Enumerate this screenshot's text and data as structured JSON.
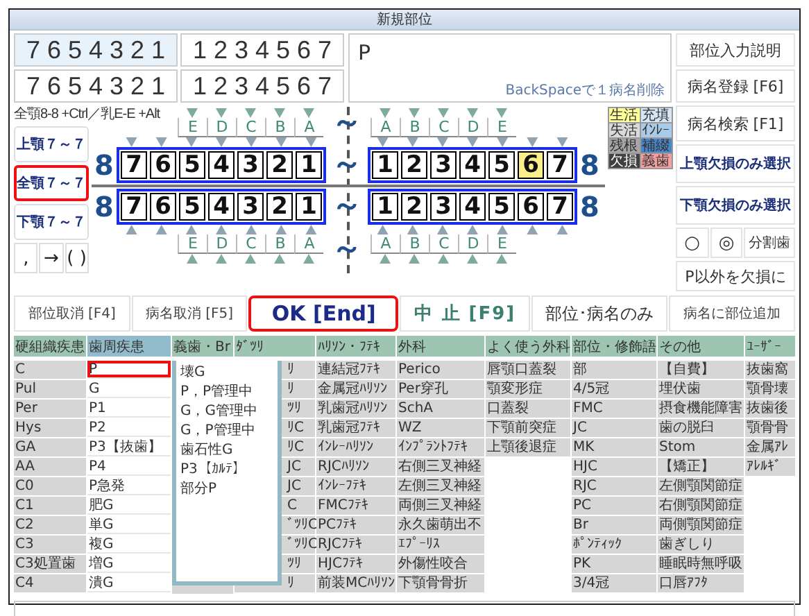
{
  "window": {
    "title": "新規部位"
  },
  "site_inputs": [
    [
      {
        "text": "7 6 5 4 3 2 1",
        "selected": true
      },
      {
        "text": "1 2 3 4 5 6 7",
        "selected": false
      }
    ],
    [
      {
        "text": "7 6 5 4 3 2 1",
        "selected": false
      },
      {
        "text": "1 2 3 4 5 6 7",
        "selected": false
      }
    ]
  ],
  "disease_input": {
    "value": "P",
    "hint": "BackSpaceで１病名削除"
  },
  "right_buttons": [
    {
      "label": "部位入力説明",
      "kind": "plain"
    },
    {
      "label": "病名登録 [F6]",
      "kind": "plain"
    },
    {
      "label": "病名検索 [F1]",
      "kind": "plain"
    },
    {
      "label": "上顎欠損のみ選択",
      "kind": "select"
    },
    {
      "label": "下顎欠損のみ選択",
      "kind": "select"
    }
  ],
  "mark_buttons": [
    "○",
    "◎",
    "分割歯"
  ],
  "missing_button": "P以外を欠損に",
  "shortcut_hint": "全顎8-8 +Ctrl／乳E-E +Alt",
  "jaw_buttons": [
    {
      "label": "上顎７～７",
      "selected": false
    },
    {
      "label": "全顎７～７",
      "selected": true
    },
    {
      "label": "下顎７～７",
      "selected": false
    }
  ],
  "symbol_keys": [
    ",",
    "→",
    "( )"
  ],
  "legend": [
    {
      "label": "生活",
      "color": "#ffff99"
    },
    {
      "label": "充填",
      "color": "#d6e6f5"
    },
    {
      "label": "失活",
      "color": "#d9d9d9"
    },
    {
      "label": "ｲﾝﾚｰ",
      "color": "#a9cbe8"
    },
    {
      "label": "残根",
      "color": "#a6a6a6"
    },
    {
      "label": "補綴",
      "color": "#4a86c5"
    },
    {
      "label": "欠損",
      "color": "#404040"
    },
    {
      "label": "義歯",
      "color": "#f4a0a0"
    }
  ],
  "chart": {
    "upper_deciduous": {
      "left": [
        "E",
        "D",
        "C",
        "B",
        "A"
      ],
      "tilde": "～",
      "right": [
        "A",
        "B",
        "C",
        "D",
        "E"
      ]
    },
    "upper": {
      "left_end": "8",
      "left": [
        {
          "label": "7",
          "marked": false
        },
        {
          "label": "6",
          "marked": false
        },
        {
          "label": "5",
          "marked": false
        },
        {
          "label": "4",
          "marked": false
        },
        {
          "label": "3",
          "marked": false
        },
        {
          "label": "2",
          "marked": false
        },
        {
          "label": "1",
          "marked": false
        }
      ],
      "tilde": "～",
      "right": [
        {
          "label": "1",
          "marked": false
        },
        {
          "label": "2",
          "marked": false
        },
        {
          "label": "3",
          "marked": false
        },
        {
          "label": "4",
          "marked": false
        },
        {
          "label": "5",
          "marked": false
        },
        {
          "label": "6",
          "marked": true
        },
        {
          "label": "7",
          "marked": false
        }
      ],
      "right_end": "8"
    },
    "lower": {
      "left_end": "8",
      "left": [
        {
          "label": "7",
          "marked": false
        },
        {
          "label": "6",
          "marked": false
        },
        {
          "label": "5",
          "marked": false
        },
        {
          "label": "4",
          "marked": false
        },
        {
          "label": "3",
          "marked": false
        },
        {
          "label": "2",
          "marked": false
        },
        {
          "label": "1",
          "marked": false
        }
      ],
      "tilde": "～",
      "right": [
        {
          "label": "1",
          "marked": false
        },
        {
          "label": "2",
          "marked": false
        },
        {
          "label": "3",
          "marked": false
        },
        {
          "label": "4",
          "marked": false
        },
        {
          "label": "5",
          "marked": false
        },
        {
          "label": "6",
          "marked": false
        },
        {
          "label": "7",
          "marked": false
        }
      ],
      "right_end": "8"
    },
    "lower_deciduous": {
      "left": [
        "E",
        "D",
        "C",
        "B",
        "A"
      ],
      "tilde": "～",
      "right": [
        "A",
        "B",
        "C",
        "D",
        "E"
      ]
    }
  },
  "actions": [
    {
      "label": "部位取消 [F4]",
      "kind": "plain",
      "focused": false
    },
    {
      "label": "病名取消 [F5]",
      "kind": "plain",
      "focused": false
    },
    {
      "label": "OK [End]",
      "kind": "ok",
      "focused": true
    },
    {
      "label": "中 止 [F9]",
      "kind": "stop",
      "focused": false
    },
    {
      "label": "部位･病名のみ",
      "kind": "large",
      "focused": false
    },
    {
      "label": "病名に部位追加",
      "kind": "plain",
      "focused": false
    }
  ],
  "tabs": [
    {
      "label": "硬組織疾患",
      "selected": false
    },
    {
      "label": "歯周疾患",
      "selected": true
    },
    {
      "label": "義歯・Br",
      "selected": false
    },
    {
      "label": "ﾀﾞﾂﾘ",
      "selected": false
    },
    {
      "label": "ﾊﾘｿﾝ・ﾌﾃｷ",
      "selected": false
    },
    {
      "label": "外科",
      "selected": false
    },
    {
      "label": "よく使う外科",
      "selected": false
    },
    {
      "label": "部位・修飾語",
      "selected": false
    },
    {
      "label": "その他",
      "selected": false
    },
    {
      "label": "ﾕｰｻﾞｰ",
      "selected": false
    }
  ],
  "columns": [
    {
      "kind": "list",
      "first_cell_focused": false,
      "cells": [
        "C",
        "Pul",
        "Per",
        "Hys",
        "GA",
        "AA",
        "C0",
        "C1",
        "C2",
        "C3",
        "C3処置歯",
        "C4"
      ]
    },
    {
      "kind": "list",
      "first_cell_focused": true,
      "cells": [
        "P",
        "G",
        "P1",
        "P2",
        "P3【抜歯】",
        "P4",
        "P急発",
        "肥G",
        "単G",
        "複G",
        "増G",
        "潰G"
      ]
    },
    {
      "kind": "covered"
    },
    {
      "kind": "partial",
      "first_cell_focused": false,
      "cells": [
        "ﾘ",
        "ﾘ",
        "ﾂﾘ",
        "ﾘC",
        "ﾘC",
        "JC",
        "JC",
        "C",
        "ﾞﾂﾘC",
        "ﾞﾂﾘC",
        "ﾂﾘ",
        "ﾘ"
      ]
    },
    {
      "kind": "list",
      "first_cell_focused": false,
      "cells": [
        "連結冠ﾌﾃｷ",
        "金属冠ﾊﾘｿﾝ",
        "乳歯冠ﾊﾘｿﾝ",
        "乳歯冠ﾌﾃｷ",
        "ｲﾝﾚｰﾊﾘｿﾝ",
        "RJCﾊﾘｿﾝ",
        "ｲﾝﾚｰﾌﾃｷ",
        "FMCﾌﾃｷ",
        "PCﾌﾃｷ",
        "RJCﾌﾃｷ",
        "HJCﾌﾃｷ",
        "前装MCﾊﾘｿﾝ"
      ]
    },
    {
      "kind": "list",
      "first_cell_focused": false,
      "cells": [
        "Perico",
        "Per穿孔",
        "SchA",
        "WZ",
        "ｲﾝﾌﾟﾗﾝﾄﾌﾃｷ",
        "右側三叉神経",
        "左側三叉神経",
        "両側三叉神経",
        "永久歯萌出不",
        "ｴﾌﾟｰﾘｽ",
        "外傷性咬合",
        "下顎骨骨折"
      ]
    },
    {
      "kind": "list",
      "first_cell_focused": false,
      "cells": [
        "唇顎口蓋裂",
        "顎変形症",
        "口蓋裂",
        "下顎前突症",
        "上顎後退症"
      ]
    },
    {
      "kind": "list",
      "first_cell_focused": false,
      "cells": [
        "部",
        "4/5冠",
        "FMC",
        "JC",
        "MK",
        "HJC",
        "RJC",
        "PC",
        "Br",
        "ﾎﾟﾝﾃｨｯｸ",
        "PK",
        "3/4冠"
      ]
    },
    {
      "kind": "list",
      "first_cell_focused": false,
      "cells": [
        "【自費】",
        "埋伏歯",
        "摂食機能障害",
        "歯の脱臼",
        "Stom",
        "【矯正】",
        "左側顎関節症",
        "右側顎関節症",
        "両側顎関節症",
        "歯ぎしり",
        "睡眠時無呼吸",
        "口唇ｱﾌﾀ"
      ]
    },
    {
      "kind": "list",
      "first_cell_focused": false,
      "cells": [
        "抜歯窩",
        "顎骨壊",
        "抜歯後",
        "顎骨骨",
        "金属ｱﾚ",
        "ｱﾚﾙｷﾞ"
      ]
    }
  ],
  "dropdown": {
    "items": [
      "壊G",
      "P，P管理中",
      "G，G管理中",
      "G，P管理中",
      "歯石性G",
      "P3【ｶﾙﾃ】",
      "部分P"
    ]
  }
}
